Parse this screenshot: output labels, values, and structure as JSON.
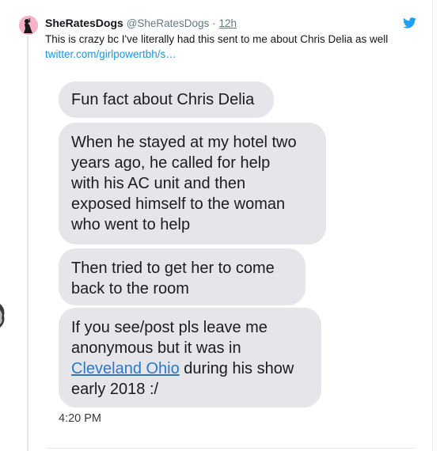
{
  "tweet": {
    "display_name": "SheRatesDogs",
    "handle": "@SheRatesDogs",
    "separator": "·",
    "time": "12h",
    "text": "This is crazy bc I've literally had this sent to me about Chris Delia as well",
    "link_text": "twitter.com/girlpowertbh/s…",
    "avatar_icon": "avatar-woman-silhouette",
    "platform_icon": "twitter-bird-icon",
    "brand_color": "#1da1f2"
  },
  "screenshot": {
    "messages": [
      {
        "text": "Fun fact about Chris Delia"
      },
      {
        "lines": [
          "When he stayed at my hotel two",
          "years ago, he called for help",
          "with his AC unit and then",
          "exposed himself to the woman",
          "who went to help"
        ]
      },
      {
        "lines": [
          "Then tried to get her to come",
          "back to the room"
        ]
      },
      {
        "line1": "If you see/post pls leave me",
        "line2": "anonymous but it was in",
        "link": "Cleveland Ohio",
        "after_link": " during his show",
        "line4": "early 2018 :/"
      }
    ],
    "timestamp": "4:20 PM"
  }
}
